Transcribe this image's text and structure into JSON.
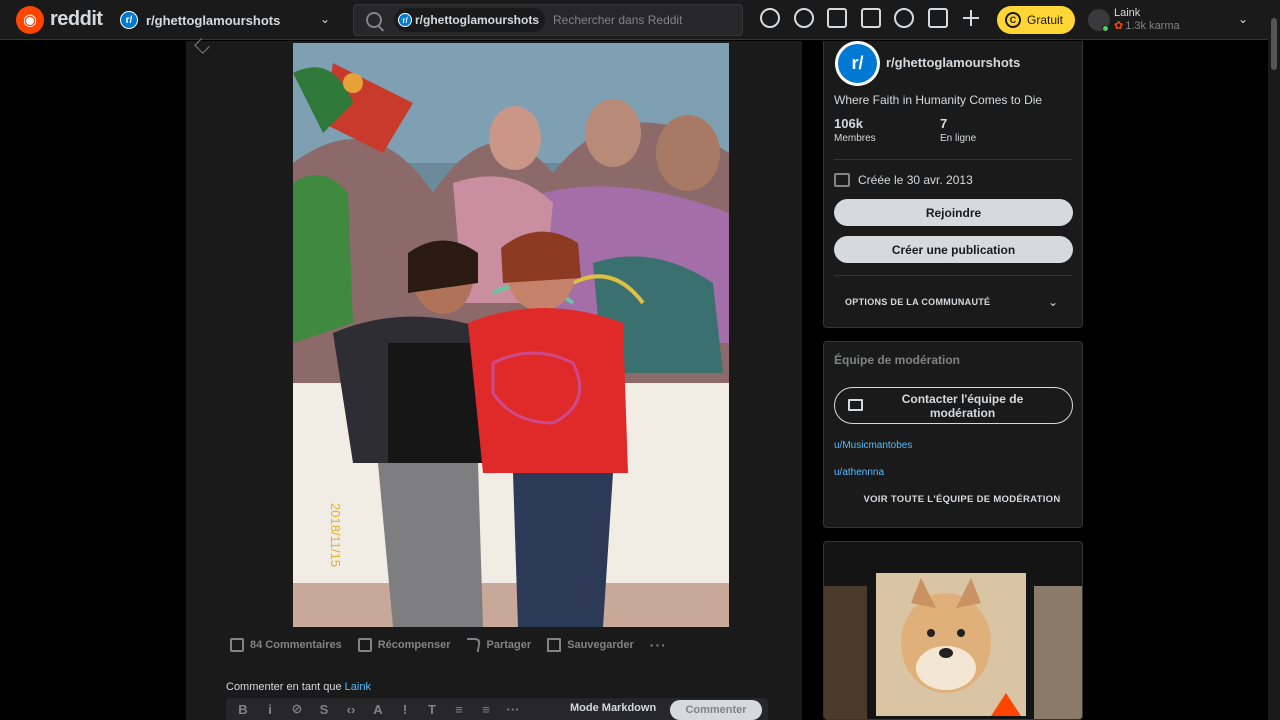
{
  "header": {
    "logo_text": "reddit",
    "community_name": "r/ghettoglamourshots",
    "search_chip": "r/ghettoglamourshots",
    "search_placeholder": "Rechercher dans Reddit",
    "premium_label": "Gratuit",
    "user_name": "Laink",
    "user_karma": "1.3k karma"
  },
  "post": {
    "photo_date_stamp": "2018/11/15",
    "actions": {
      "comments": "84 Commentaires",
      "award": "Récompenser",
      "share": "Partager",
      "save": "Sauvegarder",
      "more": "···"
    },
    "comment_as_prefix": "Commenter en tant que",
    "comment_as_user": "Laink",
    "editor": {
      "markdown_label": "Mode Markdown",
      "comment_button": "Commenter",
      "tools": [
        "B",
        "i",
        "⊘",
        "S",
        "‹›",
        "A",
        "!",
        "T",
        "≡",
        "≡",
        "···"
      ]
    }
  },
  "sidebar": {
    "community": {
      "name": "r/ghettoglamourshots",
      "description": "Where Faith in Humanity Comes to Die",
      "members_value": "106k",
      "members_label": "Membres",
      "online_value": "7",
      "online_label": "En ligne",
      "created": "Créée le 30 avr. 2013",
      "join_label": "Rejoindre",
      "create_post_label": "Créer une publication",
      "options_label": "OPTIONS DE LA COMMUNAUTÉ"
    },
    "moderators": {
      "title": "Équipe de modération",
      "contact_label": "Contacter l'équipe de modération",
      "list": [
        "u/Musicmantobes",
        "u/athennna"
      ],
      "view_all": "VOIR TOUTE L'ÉQUIPE DE MODÉRATION"
    }
  },
  "colors": {
    "background": "#000000",
    "panel": "#1a1a1b",
    "brand": "#ff4500",
    "premium": "#ffd635",
    "link": "#4fbcff"
  }
}
